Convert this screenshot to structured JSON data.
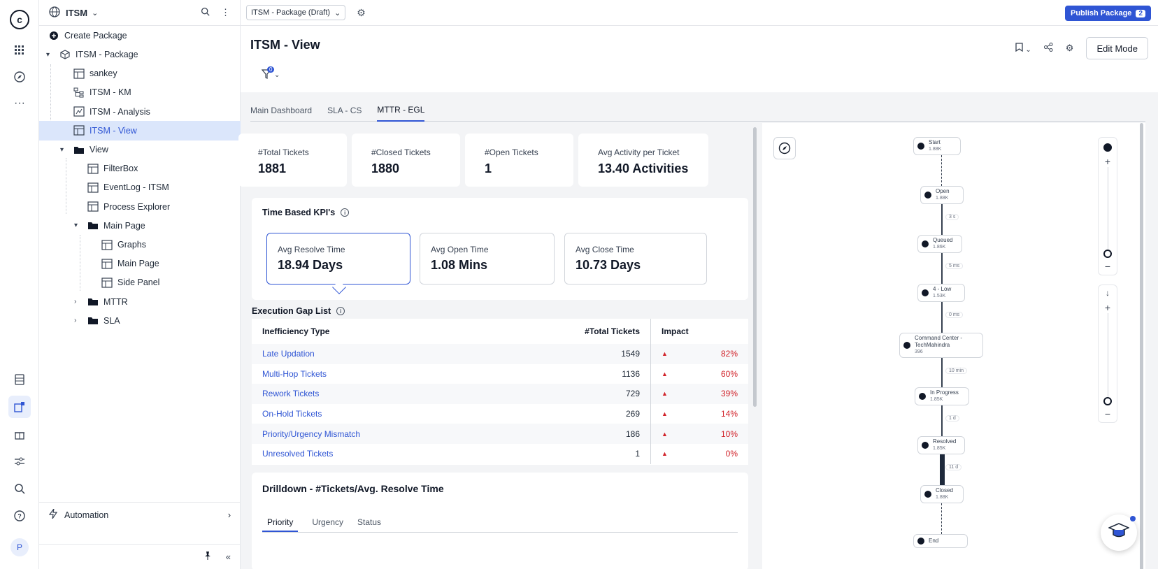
{
  "app": {
    "workspace_name": "ITSM",
    "avatar_initial": "P",
    "rail_icons": [
      "apps-grid-icon",
      "compass-icon",
      "more-horizontal-icon",
      "table-icon",
      "edit-icon",
      "gift-icon",
      "sliders-icon",
      "search-icon",
      "help-icon"
    ]
  },
  "sidebar": {
    "create_package": "Create Package",
    "tree": [
      {
        "label": "ITSM - Package",
        "depth": 0,
        "icon": "package-icon",
        "twisty": "▾"
      },
      {
        "label": "sankey",
        "depth": 1,
        "icon": "view-icon"
      },
      {
        "label": "ITSM - KM",
        "depth": 1,
        "icon": "hierarchy-icon"
      },
      {
        "label": "ITSM - Analysis",
        "depth": 1,
        "icon": "analysis-icon"
      },
      {
        "label": "ITSM - View",
        "depth": 1,
        "icon": "view-icon",
        "selected": true
      },
      {
        "label": "View",
        "depth": 1,
        "icon": "folder-icon",
        "twisty": "▾"
      },
      {
        "label": "FilterBox",
        "depth": 2,
        "icon": "view-icon"
      },
      {
        "label": "EventLog - ITSM",
        "depth": 2,
        "icon": "view-icon"
      },
      {
        "label": "Process Explorer",
        "depth": 2,
        "icon": "view-icon"
      },
      {
        "label": "Main Page",
        "depth": 2,
        "icon": "folder-icon",
        "twisty": "▾"
      },
      {
        "label": "Graphs",
        "depth": 3,
        "icon": "view-icon"
      },
      {
        "label": "Main Page",
        "depth": 3,
        "icon": "view-icon"
      },
      {
        "label": "Side Panel",
        "depth": 3,
        "icon": "view-icon"
      },
      {
        "label": "MTTR",
        "depth": 2,
        "icon": "folder-icon",
        "twisty": "›"
      },
      {
        "label": "SLA",
        "depth": 2,
        "icon": "folder-icon",
        "twisty": "›"
      }
    ],
    "automation": "Automation"
  },
  "topbar": {
    "package_select": "ITSM - Package (Draft)",
    "publish_label": "Publish Package",
    "publish_count": "2"
  },
  "page": {
    "title": "ITSM - View",
    "filter_count": "0",
    "edit_mode": "Edit Mode",
    "tabs": [
      "Main Dashboard",
      "SLA - CS",
      "MTTR - EGL"
    ],
    "active_tab": "MTTR - EGL"
  },
  "kpis": [
    {
      "label": "#Total Tickets",
      "value": "1881"
    },
    {
      "label": "#Closed Tickets",
      "value": "1880"
    },
    {
      "label": "#Open Tickets",
      "value": "1"
    },
    {
      "label": "Avg Activity per Ticket",
      "value": "13.40 Activities"
    }
  ],
  "time_kpis": {
    "title": "Time Based KPI's",
    "cards": [
      {
        "label": "Avg Resolve Time",
        "value": "18.94 Days"
      },
      {
        "label": "Avg Open Time",
        "value": "1.08 Mins"
      },
      {
        "label": "Avg Close Time",
        "value": "10.73 Days"
      }
    ]
  },
  "gap_list": {
    "title": "Execution Gap List",
    "headers": [
      "Inefficiency Type",
      "#Total Tickets",
      "Impact"
    ],
    "rows": [
      {
        "type": "Late Updation",
        "total": "1549",
        "impact": "82%"
      },
      {
        "type": "Multi-Hop Tickets",
        "total": "1136",
        "impact": "60%"
      },
      {
        "type": "Rework Tickets",
        "total": "729",
        "impact": "39%"
      },
      {
        "type": "On-Hold Tickets",
        "total": "269",
        "impact": "14%"
      },
      {
        "type": "Priority/Urgency Mismatch",
        "total": "186",
        "impact": "10%"
      },
      {
        "type": "Unresolved Tickets",
        "total": "1",
        "impact": "0%"
      }
    ]
  },
  "drilldown": {
    "title": "Drilldown - #Tickets/Avg. Resolve Time",
    "tabs": [
      "Priority",
      "Urgency",
      "Status"
    ]
  },
  "process_map": {
    "nodes": [
      {
        "name": "Start",
        "count": "1.88K"
      },
      {
        "name": "Open",
        "count": "1.88K"
      },
      {
        "name": "Queued",
        "count": "1.86K"
      },
      {
        "name": "4 - Low",
        "count": "1.53K"
      },
      {
        "name": "Command Center - TechMahindra",
        "count": "396"
      },
      {
        "name": "In Progress",
        "count": "1.85K"
      },
      {
        "name": "Resolved",
        "count": "1.85K"
      },
      {
        "name": "Closed",
        "count": "1.88K"
      },
      {
        "name": "End",
        "count": ""
      }
    ],
    "edge_labels": [
      "3 s",
      "5 ms",
      "0 ms",
      "10 min",
      "1 d",
      "11 d"
    ]
  }
}
